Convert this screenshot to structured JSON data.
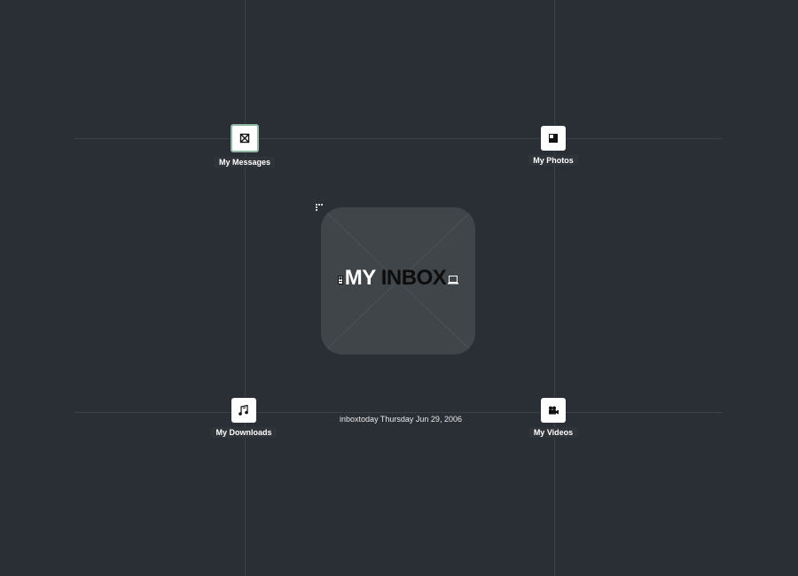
{
  "nav": {
    "messages": {
      "label": "My Messages",
      "icon": "envelope-icon",
      "active": true
    },
    "photos": {
      "label": "My Photos",
      "icon": "photo-icon",
      "active": false
    },
    "downloads": {
      "label": "My Downloads",
      "icon": "music-note-icon",
      "active": false
    },
    "videos": {
      "label": "My Videos",
      "icon": "video-camera-icon",
      "active": false
    }
  },
  "center": {
    "title_part1": "MY",
    "title_part2": "INBOX",
    "left_icon": "phone-icon",
    "right_icon": "laptop-icon"
  },
  "footer": {
    "date_line": "inboxtoday Thursday Jun 29, 2006"
  },
  "colors": {
    "background": "#2a2e35",
    "gridline": "#3c4149",
    "card": "#40454a",
    "active_border": "#8fb6a3",
    "tile": "#ffffff"
  }
}
